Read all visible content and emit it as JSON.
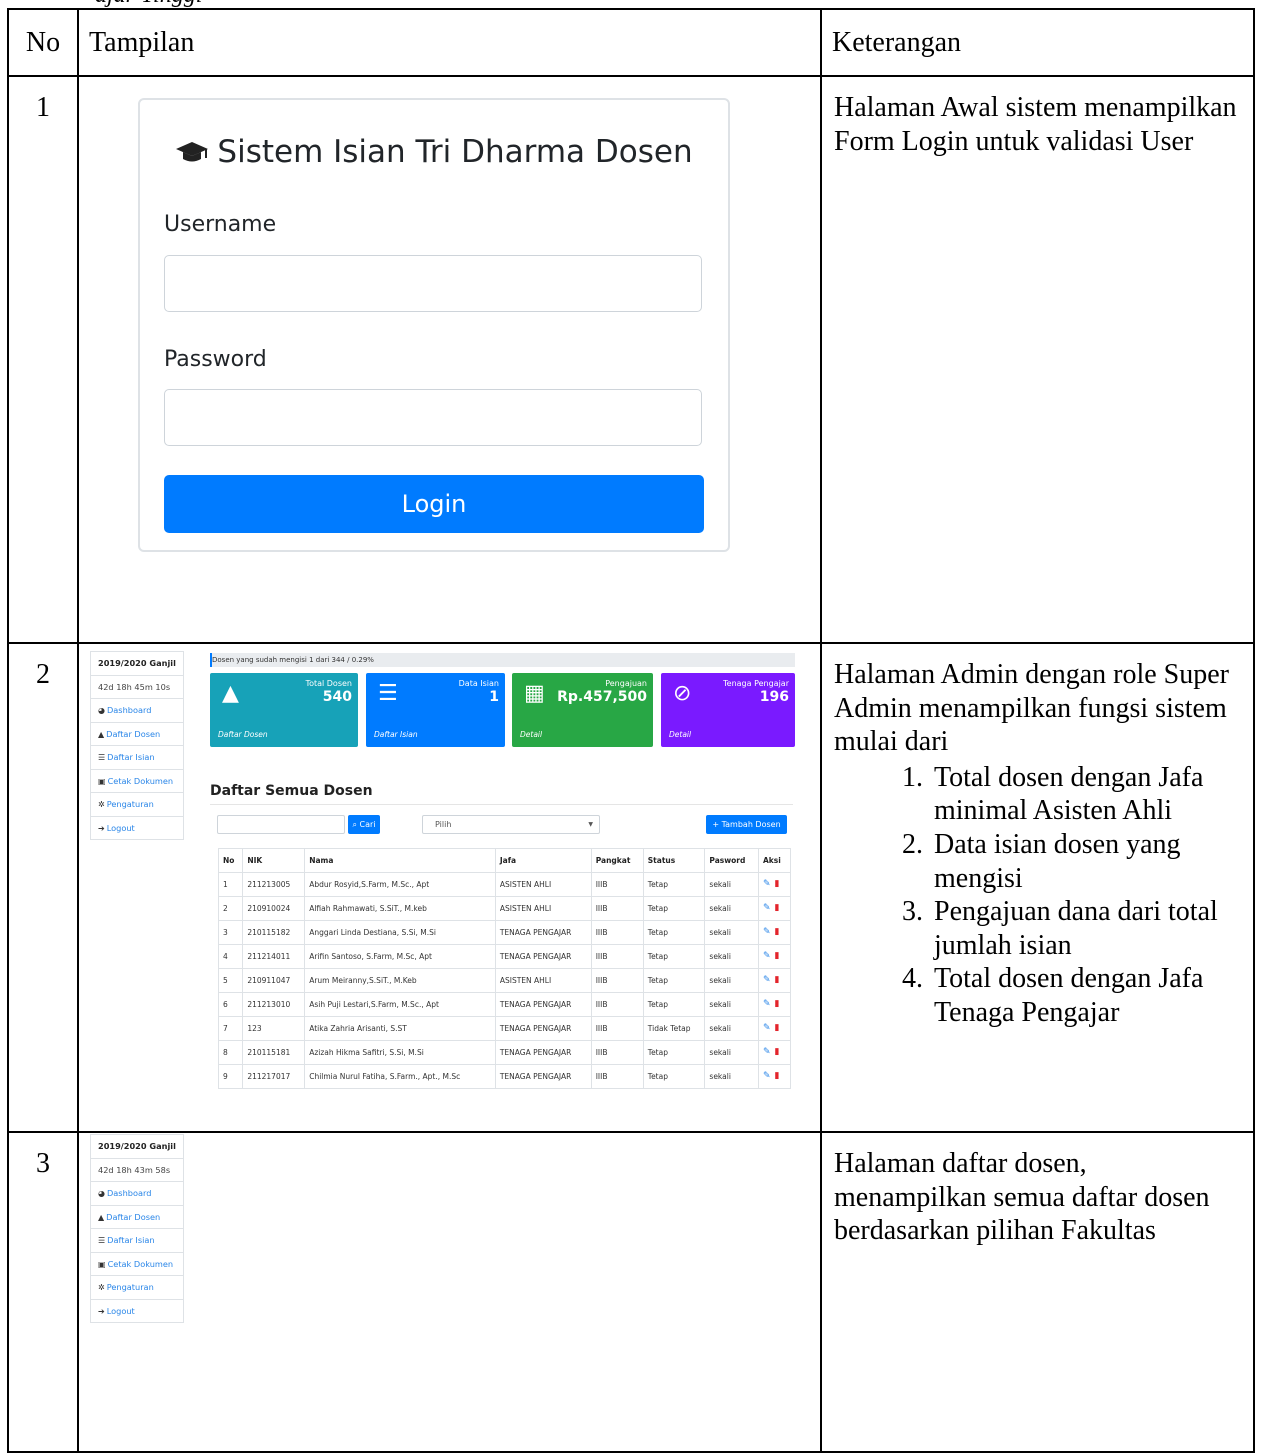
{
  "document": {
    "top_fragment": "ajar Tinggi",
    "headers": {
      "no": "No",
      "tampilan": "Tampilan",
      "keterangan": "Keterangan"
    },
    "rows": [
      {
        "no": "1",
        "keterangan": "Halaman Awal sistem menampilkan Form Login untuk validasi User"
      },
      {
        "no": "2",
        "keterangan": "Halaman Admin dengan role Super Admin menampilkan fungsi sistem mulai dari",
        "list": [
          "Total dosen dengan Jafa minimal Asisten Ahli",
          "Data isian dosen yang mengisi",
          "Pengajuan dana dari total jumlah isian",
          "Total dosen dengan Jafa Tenaga Pengajar"
        ]
      },
      {
        "no": "3",
        "keterangan": "Halaman daftar dosen, menampilkan semua daftar dosen berdasarkan pilihan Fakultas"
      }
    ]
  },
  "login": {
    "title": "Sistem Isian Tri Dharma Dosen",
    "icon": "graduation-cap-icon",
    "username_label": "Username",
    "password_label": "Password",
    "button": "Login",
    "accent": "#007bff"
  },
  "admin": {
    "sidebar": {
      "period": "2019/2020 Ganjil",
      "countdown": "42d 18h 45m 10s",
      "items": [
        "Dashboard",
        "Daftar Dosen",
        "Daftar Isian",
        "Cetak Dokumen",
        "Pengaturan",
        "Logout"
      ]
    },
    "progress": {
      "text": "Dosen yang sudah mengisi 1 dari 344 / 0.29%",
      "fraction": 0.0029
    },
    "cards": [
      {
        "label": "Total Dosen",
        "value": "540",
        "footer": "Daftar Dosen",
        "color": "#17a2b8",
        "icon": "graduate-icon"
      },
      {
        "label": "Data Isian",
        "value": "1",
        "footer": "Daftar Isian",
        "color": "#007bff",
        "icon": "list-icon"
      },
      {
        "label": "Pengajuan",
        "value": "Rp.457,500",
        "footer": "Detail",
        "color": "#28a745",
        "icon": "invoice-icon"
      },
      {
        "label": "Tenaga Pengajar",
        "value": "196",
        "footer": "Detail",
        "color": "#7a1aff",
        "icon": "ban-icon"
      }
    ]
  },
  "daftar": {
    "sidebar_countdown": "42d 18h 43m 58s",
    "title": "Daftar Semua Dosen",
    "search_button": "Cari",
    "select_value": "Pilih",
    "add_button": "Tambah Dosen",
    "columns": [
      "No",
      "NIK",
      "Nama",
      "Jafa",
      "Pangkat",
      "Status",
      "Pasword",
      "Aksi"
    ],
    "rows": [
      [
        "1",
        "211213005",
        "Abdur Rosyid,S.Farm, M.Sc., Apt",
        "ASISTEN AHLI",
        "IIIB",
        "Tetap",
        "sekali"
      ],
      [
        "2",
        "210910024",
        "Alfiah Rahmawati, S.SiT., M.keb",
        "ASISTEN AHLI",
        "IIIB",
        "Tetap",
        "sekali"
      ],
      [
        "3",
        "210115182",
        "Anggari Linda Destiana, S.Si, M.Si",
        "TENAGA PENGAJAR",
        "IIIB",
        "Tetap",
        "sekali"
      ],
      [
        "4",
        "211214011",
        "Arifin Santoso, S.Farm, M.Sc, Apt",
        "TENAGA PENGAJAR",
        "IIIB",
        "Tetap",
        "sekali"
      ],
      [
        "5",
        "210911047",
        "Arum Meiranny,S.SiT., M.Keb",
        "ASISTEN AHLI",
        "IIIB",
        "Tetap",
        "sekali"
      ],
      [
        "6",
        "211213010",
        "Asih Puji Lestari,S.Farm, M.Sc., Apt",
        "TENAGA PENGAJAR",
        "IIIB",
        "Tetap",
        "sekali"
      ],
      [
        "7",
        "123",
        "Atika Zahria Arisanti, S.ST",
        "TENAGA PENGAJAR",
        "IIIB",
        "Tidak Tetap",
        "sekali"
      ],
      [
        "8",
        "210115181",
        "Azizah Hikma Safitri, S.Si, M.Si",
        "TENAGA PENGAJAR",
        "IIIB",
        "Tetap",
        "sekali"
      ],
      [
        "9",
        "211217017",
        "Chilmia Nurul Fatiha, S.Farm., Apt., M.Sc",
        "TENAGA PENGAJAR",
        "IIIB",
        "Tetap",
        "sekali"
      ]
    ]
  }
}
